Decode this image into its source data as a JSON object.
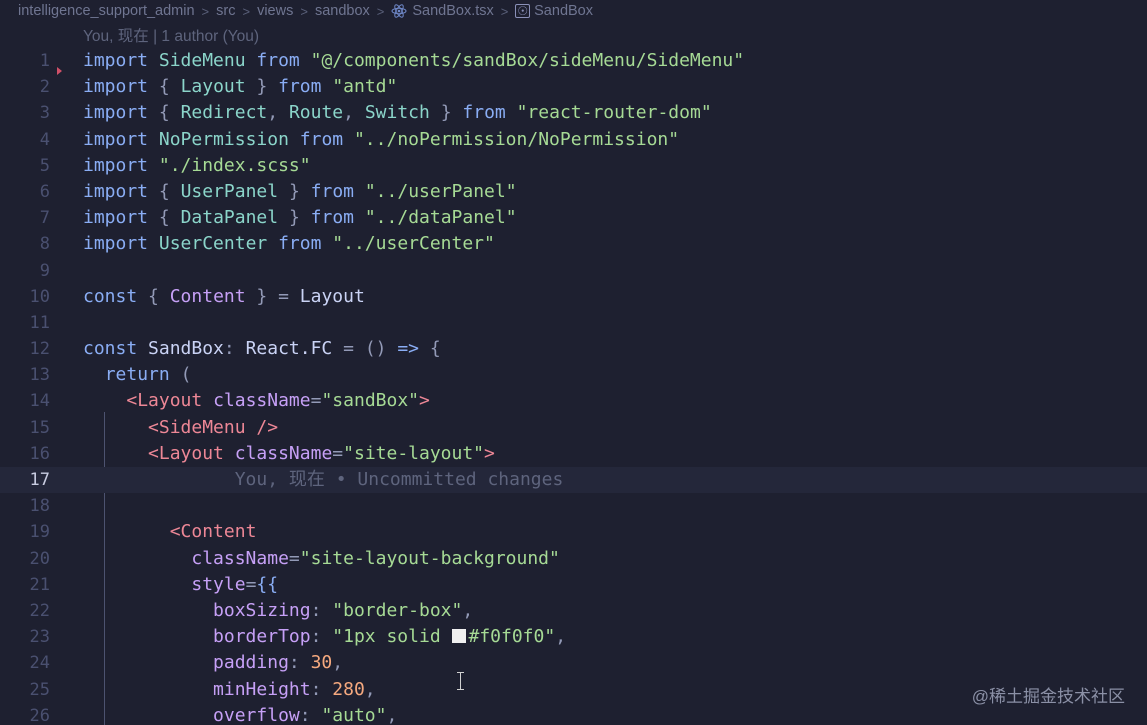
{
  "breadcrumb": {
    "segments": [
      "intelligence_support_admin",
      "src",
      "views",
      "sandbox",
      "SandBox.tsx",
      "SandBox"
    ],
    "file_icon": "react-icon",
    "symbol_icon": "symbol-class-icon"
  },
  "blame_header": "You, 现在 | 1 author (You)",
  "inline_blame": "You, 现在 • Uncommitted changes",
  "line_numbers": [
    "1",
    "2",
    "3",
    "4",
    "5",
    "6",
    "7",
    "8",
    "9",
    "10",
    "11",
    "12",
    "13",
    "14",
    "15",
    "16",
    "17",
    "18",
    "19",
    "20",
    "21",
    "22",
    "23",
    "24",
    "25",
    "26"
  ],
  "code": {
    "kw_import": "import",
    "kw_from": "from",
    "kw_const": "const",
    "kw_return": "return",
    "l1_id": "SideMenu",
    "l1_str": "\"@/components/sandBox/sideMenu/SideMenu\"",
    "l2_id": "Layout",
    "l2_str": "\"antd\"",
    "l3_id1": "Redirect",
    "l3_id2": "Route",
    "l3_id3": "Switch",
    "l3_str": "\"react-router-dom\"",
    "l4_id": "NoPermission",
    "l4_str": "\"../noPermission/NoPermission\"",
    "l5_str": "\"./index.scss\"",
    "l6_id": "UserPanel",
    "l6_str": "\"../userPanel\"",
    "l7_id": "DataPanel",
    "l7_str": "\"../dataPanel\"",
    "l8_id": "UserCenter",
    "l8_str": "\"../userCenter\"",
    "l10_id": "Content",
    "l10_val": "Layout",
    "l12_name": "SandBox",
    "l12_type": "React.FC",
    "l14_tag": "Layout",
    "l14_attr": "className",
    "l14_val": "\"sandBox\"",
    "l15_tag": "SideMenu",
    "l16_tag": "Layout",
    "l16_attr": "className",
    "l16_val": "\"site-layout\"",
    "l19_tag": "Content",
    "l20_attr": "className",
    "l20_val": "\"site-layout-background\"",
    "l21_attr": "style",
    "l22_prop": "boxSizing",
    "l22_val": "\"border-box\"",
    "l23_prop": "borderTop",
    "l23_val_a": "\"1px solid ",
    "l23_val_b": "#f0f0f0\"",
    "l24_prop": "padding",
    "l24_val": "30",
    "l25_prop": "minHeight",
    "l25_val": "280",
    "l26_prop": "overflow",
    "l26_val": "\"auto\""
  },
  "watermark": "@稀土掘金技术社区",
  "colors": {
    "background": "#1e2030",
    "keyword": "#8aadf4",
    "identifier": "#8bd5ca",
    "string": "#a6da95",
    "tag": "#ed8796",
    "attribute": "#c6a0f6",
    "number": "#f5a97f",
    "swatch": "#f0f0f0"
  }
}
